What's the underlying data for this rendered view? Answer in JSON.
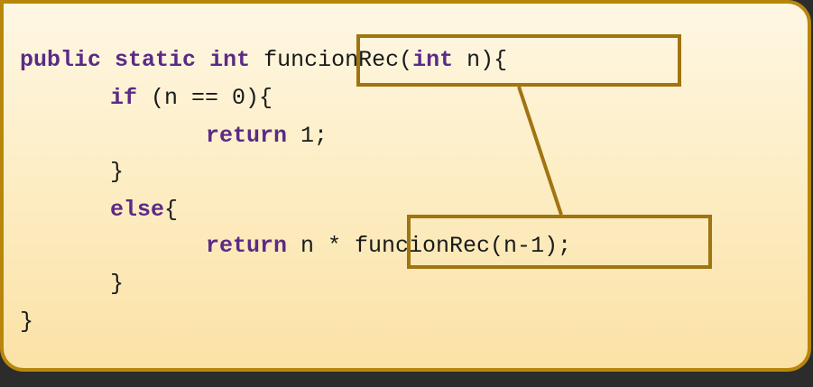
{
  "code": {
    "line1": {
      "kw1": "public",
      "kw2": "static",
      "kw3": "int",
      "call_name": "funcionRec(",
      "call_kw": "int",
      "call_rest": " n)",
      "tail": "{"
    },
    "line2": {
      "kw": "if",
      "rest": " (n == 0){"
    },
    "line3": {
      "kw": "return",
      "rest": " 1;"
    },
    "line4": {
      "text": "}"
    },
    "line5": {
      "kw": "else",
      "rest": "{"
    },
    "line6": {
      "kw": "return",
      "rest": " n * ",
      "call": "funcionRec(n-1);"
    },
    "line7": {
      "text": "}"
    },
    "line8": {
      "text": "}"
    }
  },
  "colors": {
    "keyword": "#5b2a86",
    "highlight_box": "#a07410",
    "panel_border": "#b8860b"
  }
}
